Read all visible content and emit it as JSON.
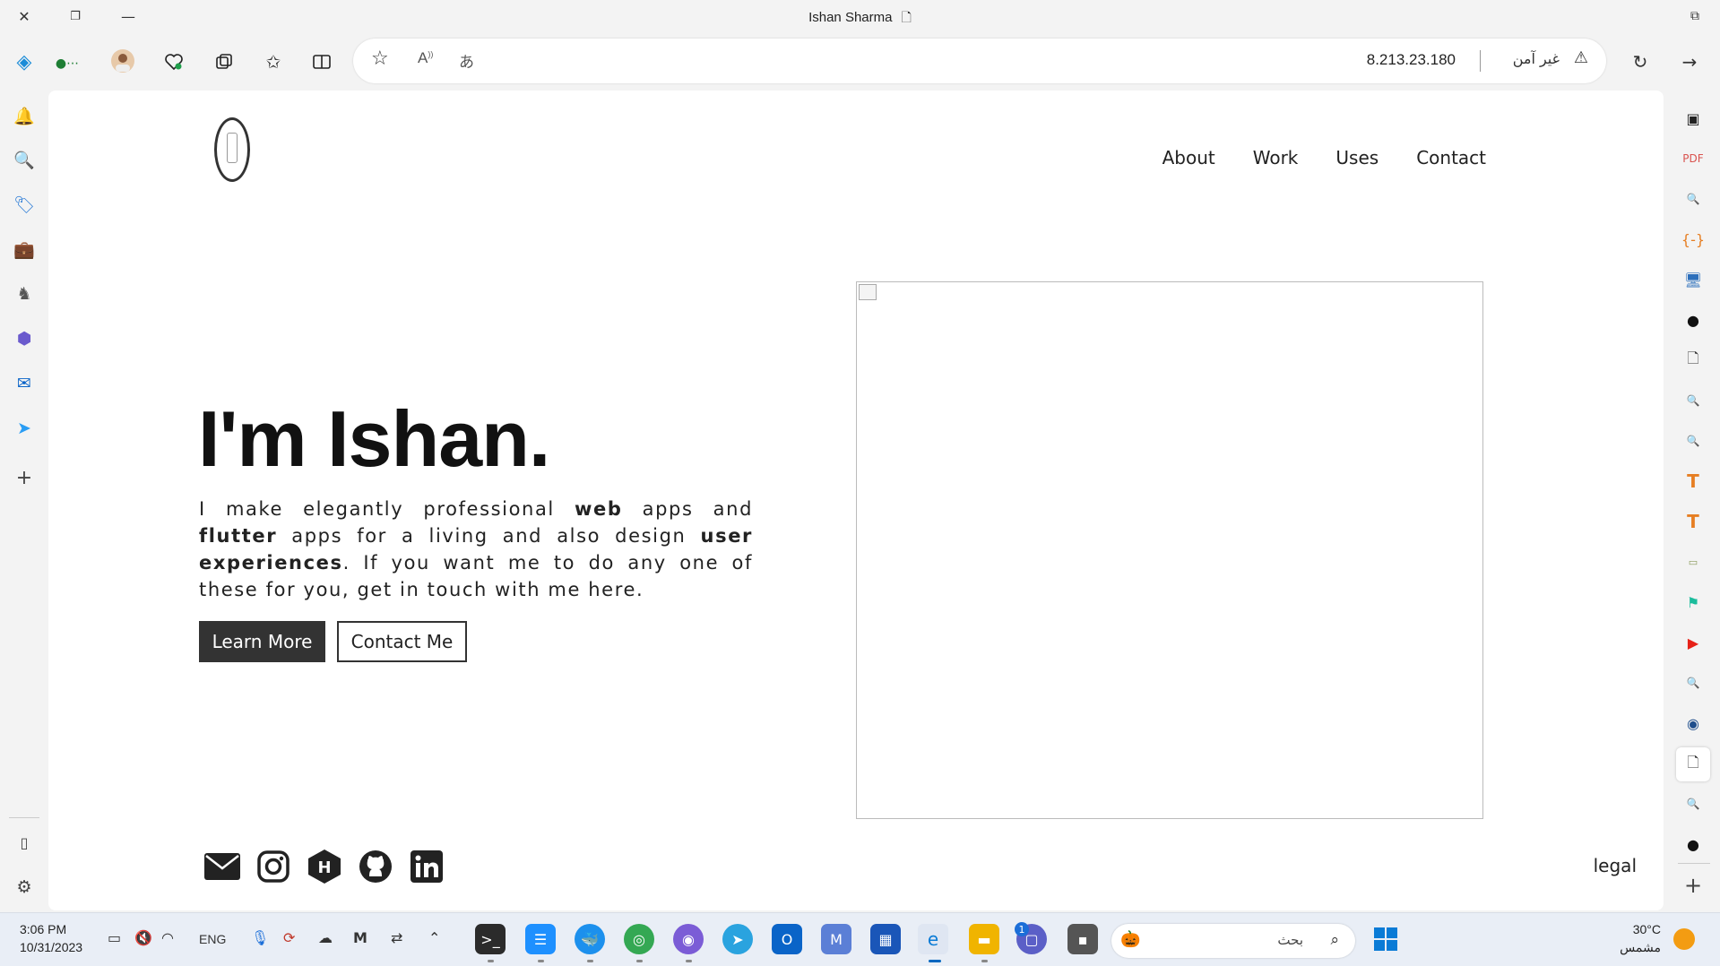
{
  "window": {
    "title": "Ishan Sharma"
  },
  "address_bar": {
    "url": "8.213.23.180",
    "security_label": "غير آمن"
  },
  "site": {
    "nav": [
      "About",
      "Work",
      "Uses",
      "Contact"
    ],
    "hero_title": "I'm Ishan.",
    "hero_text": {
      "p1": "I make elegantly professional ",
      "b1": "web",
      "p2": " apps and ",
      "b2": "flutter",
      "p3": " apps for a living and also design ",
      "b3": "user experiences",
      "p4": ". If you want me to do any one of these for you, get in touch with me here."
    },
    "learn_more": "Learn More",
    "contact_me": "Contact Me",
    "legal": "legal",
    "socials": [
      "mail-icon",
      "instagram-icon",
      "hashnode-icon",
      "github-icon",
      "linkedin-icon"
    ]
  },
  "taskbar": {
    "time": "3:06 PM",
    "date": "10/31/2023",
    "language": "ENG",
    "search_placeholder": "بحث",
    "temperature": "30°C",
    "weather": "مشمس",
    "chat_badge": "1"
  },
  "colors": {
    "accent": "#0067c0",
    "button_dark": "#333333"
  }
}
